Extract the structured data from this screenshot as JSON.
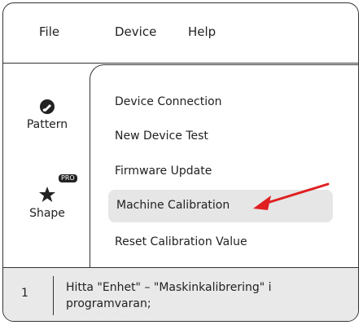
{
  "menu": {
    "file": "File",
    "device": "Device",
    "help": "Help"
  },
  "tools": {
    "pattern": "Pattern",
    "shape": "Shape",
    "pro_badge": "PRO"
  },
  "device_menu": {
    "items": [
      "Device Connection",
      "New Device Test",
      "Firmware Update",
      "Machine Calibration",
      "Reset Calibration Value"
    ],
    "highlighted": "Machine Calibration",
    "highlight_color": "#e6e6e6",
    "arrow_color": "#e02020"
  },
  "instruction": {
    "step": "1",
    "text": "Hitta \"Enhet\" – \"Maskinkalibrering\" i programvaran;"
  },
  "icons": {
    "pattern": "brush-icon",
    "shape": "star-icon"
  }
}
